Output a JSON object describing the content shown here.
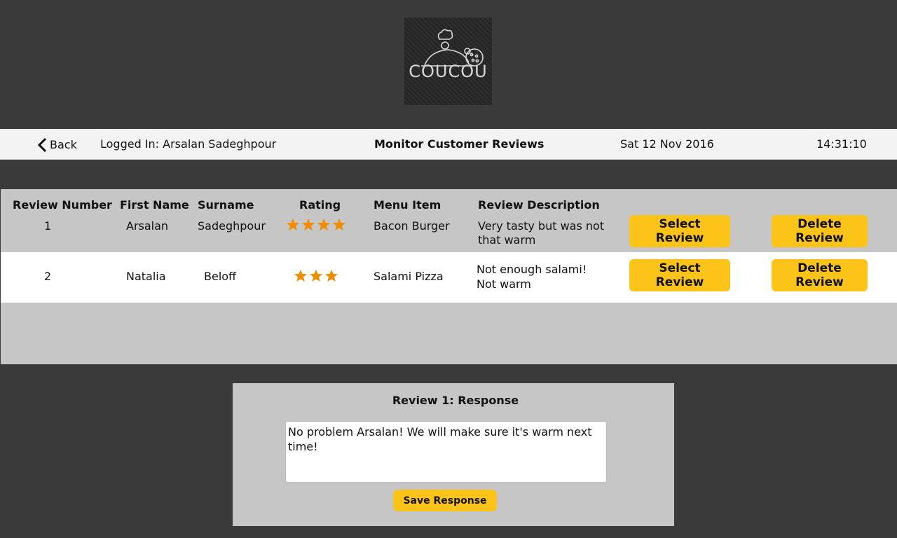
{
  "logo": {
    "text": "COUCOU"
  },
  "header": {
    "back_label": "Back",
    "logged_in": "Logged In: Arsalan Sadeghpour",
    "title": "Monitor Customer Reviews",
    "date": "Sat 12 Nov 2016",
    "time": "14:31:10"
  },
  "table": {
    "columns": [
      "Review Number",
      "First Name",
      "Surname",
      "Rating",
      "Menu Item",
      "Review Description"
    ],
    "rows": [
      {
        "number": "1",
        "first_name": "Arsalan",
        "surname": "Sadeghpour",
        "rating": 4,
        "menu_item": "Bacon Burger",
        "description_line1": "Very tasty but was not",
        "description_line2": "that warm",
        "select_label": "Select Review",
        "delete_label": "Delete Review"
      },
      {
        "number": "2",
        "first_name": "Natalia",
        "surname": "Beloff",
        "rating": 3,
        "menu_item": "Salami Pizza",
        "description_line1": "Not enough salami!",
        "description_line2": "Not warm",
        "select_label": "Select Review",
        "delete_label": "Delete Review"
      }
    ]
  },
  "response": {
    "title": "Review 1: Response",
    "text": "No problem Arsalan! We will make sure it's warm next time!",
    "save_label": "Save Response"
  },
  "colors": {
    "accent": "#fcc419",
    "star": "#f08c00",
    "panel": "#c6c6c6",
    "background": "#3a3a3a"
  }
}
